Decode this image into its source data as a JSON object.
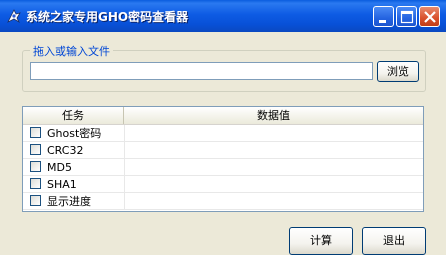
{
  "window": {
    "title": "系统之家专用GHO密码查看器"
  },
  "file_group": {
    "label": "拖入或输入文件",
    "path_value": "",
    "browse_label": "浏览"
  },
  "list": {
    "columns": [
      "任务",
      "数据值"
    ],
    "rows": [
      {
        "label": "Ghost密码",
        "value": "",
        "checked": false
      },
      {
        "label": "CRC32",
        "value": "",
        "checked": false
      },
      {
        "label": "MD5",
        "value": "",
        "checked": false
      },
      {
        "label": "SHA1",
        "value": "",
        "checked": false
      },
      {
        "label": "显示进度",
        "value": "",
        "checked": false
      }
    ]
  },
  "actions": {
    "calc_label": "计算",
    "quit_label": "退出"
  },
  "colors": {
    "titlebar": "#0a5cde",
    "group_label": "#0046d5",
    "face": "#ece9d8"
  },
  "icons": [
    "app-icon",
    "minimize-icon",
    "maximize-icon",
    "close-icon"
  ]
}
